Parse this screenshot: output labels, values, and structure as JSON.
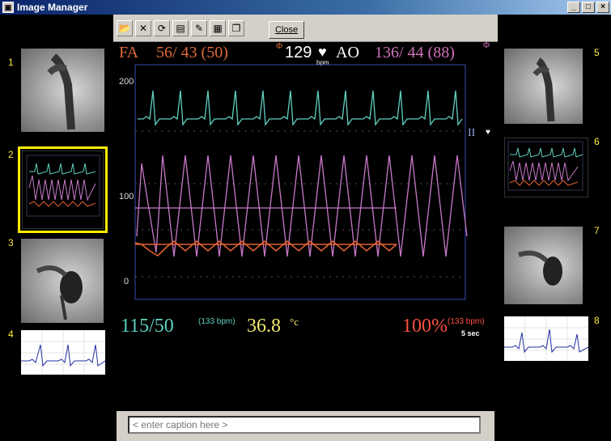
{
  "window": {
    "title": "Image Manager",
    "buttons": [
      "_",
      "□",
      "×"
    ]
  },
  "toolbar": {
    "close_label": "Close"
  },
  "thumbnails": [
    {
      "num": "1"
    },
    {
      "num": "2"
    },
    {
      "num": "3"
    },
    {
      "num": "4"
    },
    {
      "num": "5"
    },
    {
      "num": "6"
    },
    {
      "num": "7"
    },
    {
      "num": "8"
    }
  ],
  "monitor": {
    "fa_label": "FA",
    "fa_pressure": "56/ 43 (50)",
    "hr_value": "129",
    "hr_unit": "bpm",
    "ao_label": "AO",
    "ao_pressure": "136/ 44 (88)",
    "lead_label": "II",
    "y_labels": [
      "200",
      "100",
      "0"
    ],
    "nibp": "115/50",
    "nibp_hr": "(133 bpm)",
    "temp": "36.8",
    "temp_unit": "°c",
    "spo2": "100%",
    "spo2_hr": "(133 bpm)",
    "sweep": "5 sec"
  },
  "caption": {
    "placeholder": "< enter caption here >"
  },
  "colors": {
    "ecg": "#5fd0c0",
    "ao_wave": "#c878c8",
    "fa_wave": "#e06030",
    "fa_text": "#e06a3a",
    "ao_text": "#d070b8",
    "temp_text": "#f0e870",
    "spo2_text": "#ff5040",
    "selected_outline": "#ffeb00"
  }
}
